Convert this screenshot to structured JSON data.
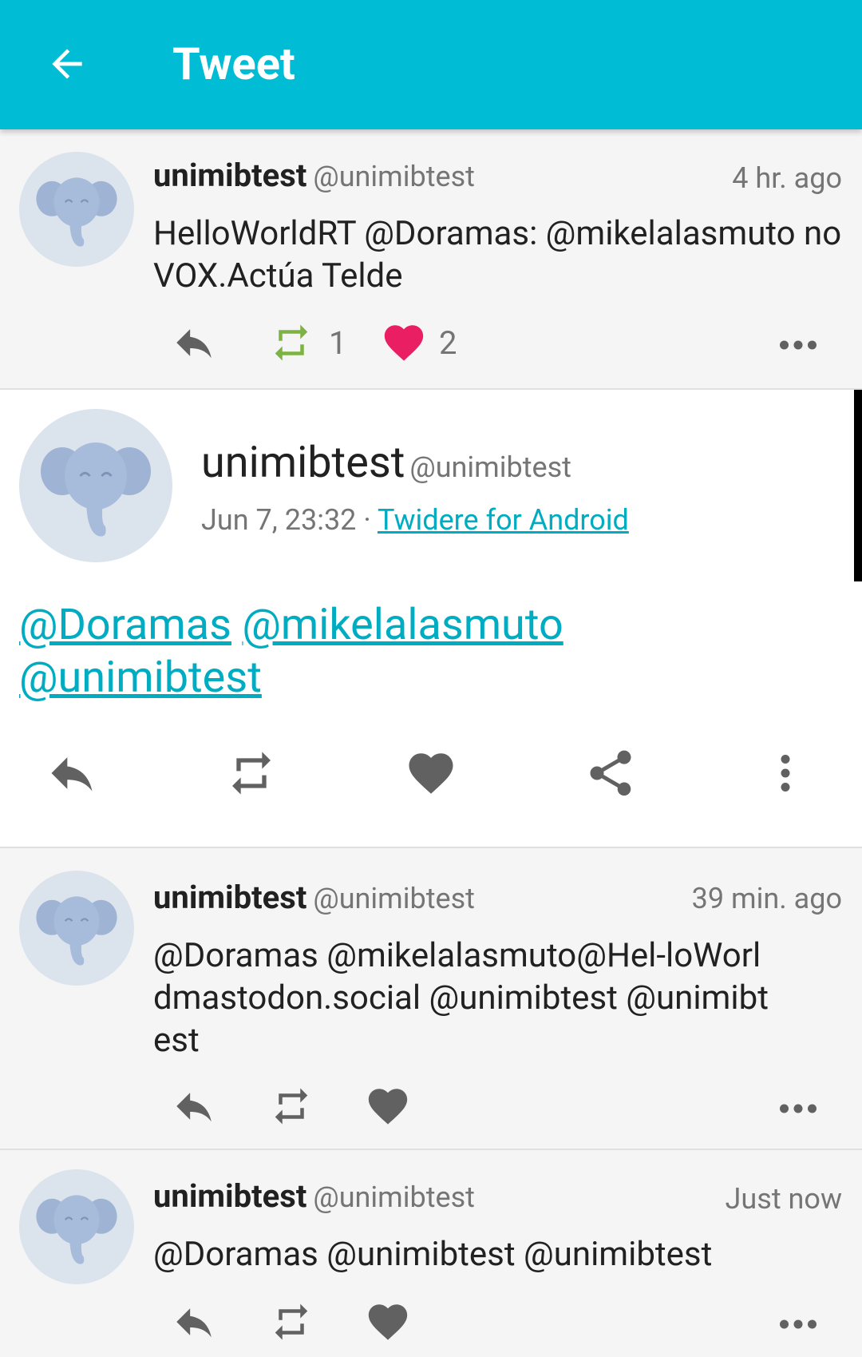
{
  "appbar": {
    "title": "Tweet"
  },
  "tweets": [
    {
      "name": "unimibtest",
      "handle": "@unimibtest",
      "time": "4 hr. ago",
      "text": "HelloWorldRT @Doramas: @mikelalasmuto no VOX.Actúa Telde",
      "retweet_count": "1",
      "like_count": "2"
    },
    {
      "name": "unimibtest",
      "handle": "@unimibtest",
      "time": "39 min. ago",
      "text": "@Doramas @mikelalasmuto@Hel-loWorldmastodon.social @unimibtest @unimibtest"
    },
    {
      "name": "unimibtest",
      "handle": "@unimibtest",
      "time": "Just now",
      "text": "@Doramas @unimibtest @unimibtest"
    }
  ],
  "detail": {
    "name": "unimibtest",
    "handle": "@unimibtest",
    "date": "Jun 7, 23:32",
    "separator": "·",
    "source": "Twidere for Android",
    "mentions": [
      "@Doramas",
      "@mikelalasmuto",
      "@unimibtest"
    ]
  },
  "colors": {
    "appbar": "#00bcd4",
    "link": "#00acc1",
    "retweet_active": "#7cb342",
    "like_active": "#e91e63",
    "icon_gray": "#757575"
  }
}
